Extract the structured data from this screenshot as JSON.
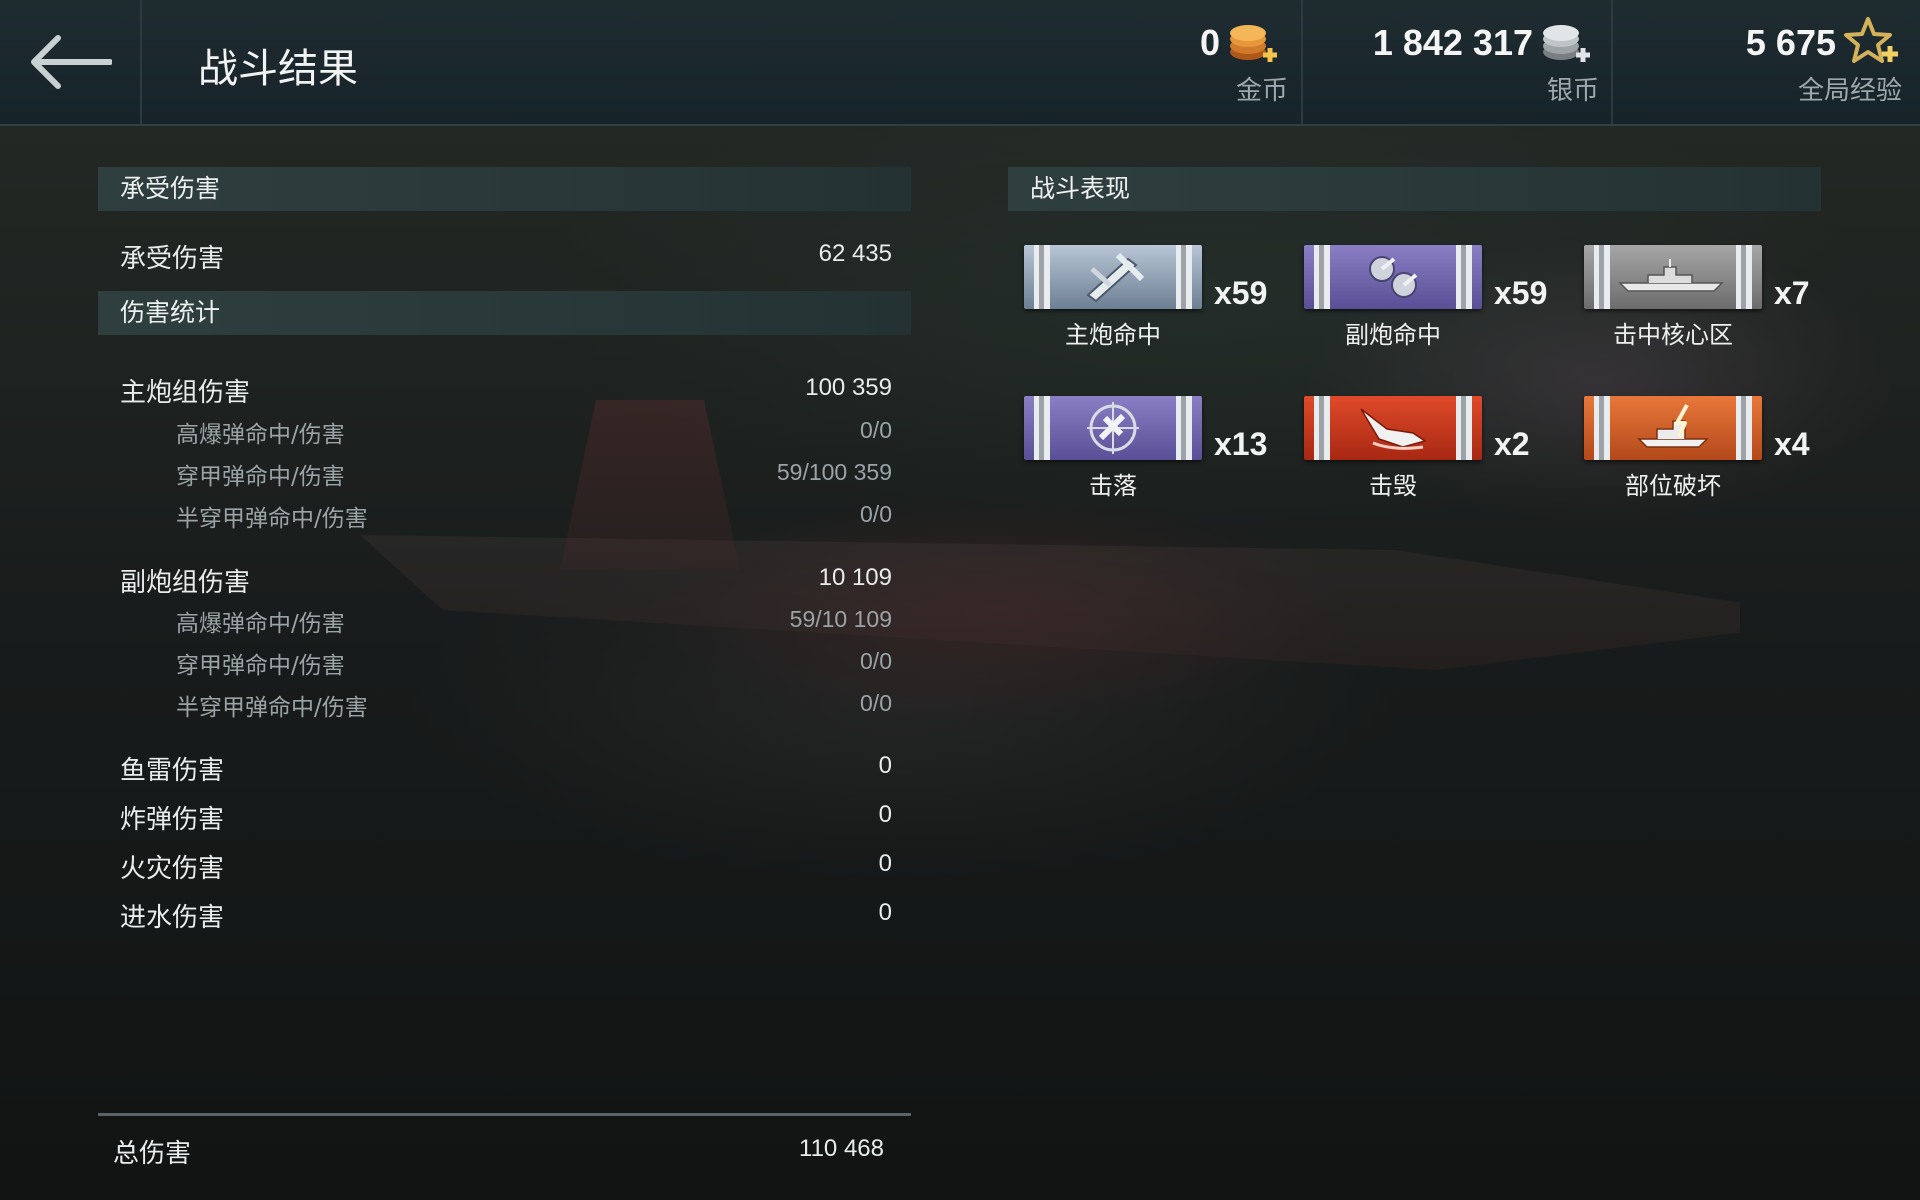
{
  "header": {
    "title": "战斗结果",
    "currencies": [
      {
        "amount": "0",
        "label": "金币",
        "icon": "gold-coins-icon"
      },
      {
        "amount": "1 842 317",
        "label": "银币",
        "icon": "silver-coins-icon"
      },
      {
        "amount": "5 675",
        "label": "全局经验",
        "icon": "star-xp-icon"
      }
    ]
  },
  "left": {
    "received": {
      "header": "承受伤害",
      "label": "承受伤害",
      "value": "62 435"
    },
    "stats_header": "伤害统计",
    "main_battery": {
      "label": "主炮组伤害",
      "value": "100 359",
      "rows": [
        {
          "label": "高爆弹命中/伤害",
          "value": "0/0"
        },
        {
          "label": "穿甲弹命中/伤害",
          "value": "59/100 359"
        },
        {
          "label": "半穿甲弹命中/伤害",
          "value": "0/0"
        }
      ]
    },
    "secondary_battery": {
      "label": "副炮组伤害",
      "value": "10 109",
      "rows": [
        {
          "label": "高爆弹命中/伤害",
          "value": "59/10 109"
        },
        {
          "label": "穿甲弹命中/伤害",
          "value": "0/0"
        },
        {
          "label": "半穿甲弹命中/伤害",
          "value": "0/0"
        }
      ]
    },
    "other": [
      {
        "label": "鱼雷伤害",
        "value": "0"
      },
      {
        "label": "炸弹伤害",
        "value": "0"
      },
      {
        "label": "火灾伤害",
        "value": "0"
      },
      {
        "label": "进水伤害",
        "value": "0"
      }
    ],
    "total": {
      "label": "总伤害",
      "value": "110 468"
    }
  },
  "right": {
    "header": "战斗表现",
    "medals": [
      {
        "label": "主炮命中",
        "count": "x59",
        "icon": "main-battery-hit-icon",
        "color": "#8ea0b4"
      },
      {
        "label": "副炮命中",
        "count": "x59",
        "icon": "secondary-battery-hit-icon",
        "color": "#7467b0"
      },
      {
        "label": "击中核心区",
        "count": "x7",
        "icon": "citadel-hit-icon",
        "color": "#8a8a8a"
      },
      {
        "label": "击落",
        "count": "x13",
        "icon": "plane-shot-down-icon",
        "color": "#7467b0"
      },
      {
        "label": "击毁",
        "count": "x2",
        "icon": "ship-destroyed-icon",
        "color": "#c8381c"
      },
      {
        "label": "部位破坏",
        "count": "x4",
        "icon": "module-destroyed-icon",
        "color": "#d06028"
      }
    ]
  }
}
